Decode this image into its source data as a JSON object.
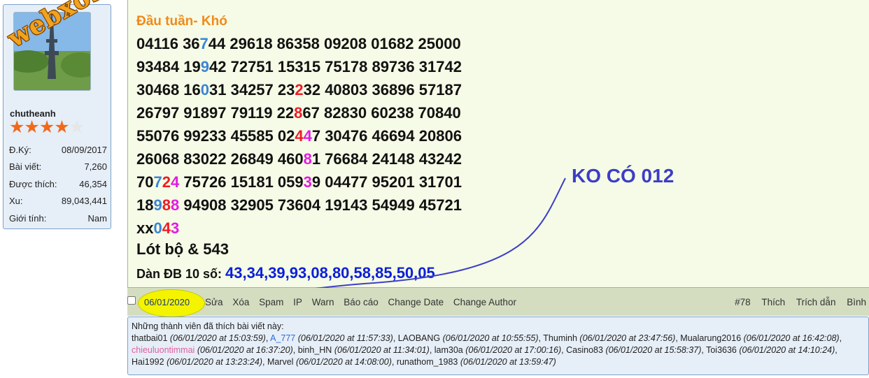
{
  "sidebar": {
    "watermark": "webxoso.net",
    "username": "chutheanh",
    "stars_filled": 4,
    "stars_total": 5,
    "stats": [
      {
        "label": "Đ.Ký:",
        "value": "08/09/2017"
      },
      {
        "label": "Bài viết:",
        "value": "7,260"
      },
      {
        "label": "Được thích:",
        "value": "46,354"
      },
      {
        "label": "Xu:",
        "value": "89,043,441"
      },
      {
        "label": "Giới tính:",
        "value": "Nam"
      }
    ]
  },
  "post": {
    "title": "Đầu tuần- Khó",
    "number_lines": [
      [
        [
          "04116 36",
          ""
        ],
        [
          "7",
          "blue"
        ],
        [
          "44 29618 86358 09208 01682 25000",
          ""
        ]
      ],
      [
        [
          "93484 19",
          ""
        ],
        [
          "9",
          "blue"
        ],
        [
          "42 72751 15315 75178 89736 31742",
          ""
        ]
      ],
      [
        [
          "30468 16",
          ""
        ],
        [
          "0",
          "blue"
        ],
        [
          "31 34257 23",
          ""
        ],
        [
          "2",
          "red"
        ],
        [
          "32 40803 36896 57187",
          ""
        ]
      ],
      [
        [
          "26797 91897 79119 22",
          ""
        ],
        [
          "8",
          "red"
        ],
        [
          "67 82830 60238 70840",
          ""
        ]
      ],
      [
        [
          "55076 99233 45585 02",
          ""
        ],
        [
          "4",
          "red"
        ],
        [
          "4",
          "magenta"
        ],
        [
          "7 30476 46694 20806",
          ""
        ]
      ],
      [
        [
          "26068 83022 26849 460",
          ""
        ],
        [
          "8",
          "magenta"
        ],
        [
          "1 76684 24148 43242",
          ""
        ]
      ],
      [
        [
          "70",
          ""
        ],
        [
          "7",
          "blue"
        ],
        [
          "2",
          "red"
        ],
        [
          "4",
          "magenta"
        ],
        [
          " 75726 15181 059",
          ""
        ],
        [
          "3",
          "magenta"
        ],
        [
          "9 04477 95201 31701",
          ""
        ]
      ],
      [
        [
          "18",
          ""
        ],
        [
          "9",
          "blue"
        ],
        [
          "8",
          "red"
        ],
        [
          "8",
          "magenta"
        ],
        [
          " 94908 32905 73604 19143 54949 45721",
          ""
        ]
      ],
      [
        [
          "xx",
          ""
        ],
        [
          "0",
          "blue"
        ],
        [
          "4",
          "red"
        ],
        [
          "3",
          "magenta"
        ]
      ]
    ],
    "lot_line": "Lót bộ & 543",
    "dan_label": "Dàn ĐB 10 số: ",
    "dan_values": "43,34,39,93,08,80,58,85,50,05",
    "annotation": "KO CÓ 012"
  },
  "action_bar": {
    "date": "06/01/2020",
    "actions": [
      "Sửa",
      "Xóa",
      "Spam",
      "IP",
      "Warn",
      "Báo cáo",
      "Change Date",
      "Change Author"
    ],
    "post_number": "#78",
    "right_actions": [
      "Thích",
      "Trích dẫn",
      "Bình"
    ]
  },
  "likes": {
    "heading": "Những thành viên đã thích bài viết này:",
    "entries": [
      {
        "name": "thatbai01",
        "time": "(06/01/2020 at 15:03:59)",
        "style": ""
      },
      {
        "name": "A_777",
        "time": "(06/01/2020 at 11:57:33)",
        "style": "blue"
      },
      {
        "name": "LAOBANG",
        "time": "(06/01/2020 at 10:55:55)",
        "style": ""
      },
      {
        "name": "Thuminh",
        "time": "(06/01/2020 at 23:47:56)",
        "style": ""
      },
      {
        "name": "Mualarung2016",
        "time": "(06/01/2020 at 16:42:08)",
        "style": ""
      },
      {
        "name": "chieuluontimmai",
        "time": "(06/01/2020 at 16:37:20)",
        "style": "pink"
      },
      {
        "name": "binh_HN",
        "time": "(06/01/2020 at 11:34:01)",
        "style": ""
      },
      {
        "name": "lam30a",
        "time": "(06/01/2020 at 17:00:16)",
        "style": ""
      },
      {
        "name": "Casino83",
        "time": "(06/01/2020 at 15:58:37)",
        "style": ""
      },
      {
        "name": "Toi3636",
        "time": "(06/01/2020 at 14:10:24)",
        "style": ""
      },
      {
        "name": "Hai1992",
        "time": "(06/01/2020 at 13:23:24)",
        "style": ""
      },
      {
        "name": "Marvel",
        "time": "(06/01/2020 at 14:08:00)",
        "style": ""
      },
      {
        "name": "runathom_1983",
        "time": "(06/01/2020 at 13:59:47)",
        "style": ""
      }
    ]
  },
  "colors": {
    "title_orange": "#f08a1a",
    "digit_blue": "#3a85d6",
    "digit_red": "#ee1c24",
    "digit_magenta": "#e21ce0",
    "annotation_color": "#3d3dc7",
    "highlight_yellow": "#f4f400"
  }
}
